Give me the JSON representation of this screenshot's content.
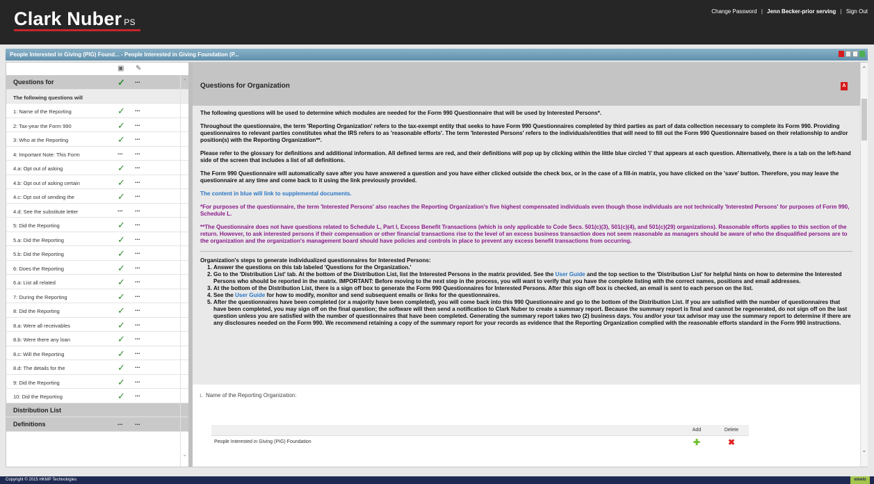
{
  "header": {
    "logo": "Clark Nuber",
    "logo_suffix": "PS",
    "links": [
      "Change Password",
      "Jenn Becker-prior serving",
      "Sign Out"
    ],
    "separator": "|"
  },
  "titlebar": {
    "title": "People Interested in Giving (PIG) Found... - People Interested in Giving Foundation (P..."
  },
  "sidebar": {
    "header_icons": [
      "print-icon",
      "pencil-icon"
    ],
    "items": [
      {
        "label": "Questions for",
        "check": "✓",
        "dots": "...",
        "type": "sec"
      },
      {
        "label": "The following questions will",
        "check": "",
        "dots": "",
        "type": "note"
      },
      {
        "label": "1: Name of the Reporting",
        "check": "✓",
        "dots": "..."
      },
      {
        "label": "2: Tax-year the Form 990",
        "check": "✓",
        "dots": "..."
      },
      {
        "label": "3: Who at the Reporting",
        "check": "✓",
        "dots": "..."
      },
      {
        "label": "4: Important Note: This Form",
        "check": "...",
        "dots": "..."
      },
      {
        "label": "4.a: Opt out of asking",
        "check": "✓",
        "dots": "..."
      },
      {
        "label": "4.b: Opt out of asking certain",
        "check": "✓",
        "dots": "..."
      },
      {
        "label": "4.c: Opt out of sending the",
        "check": "✓",
        "dots": "..."
      },
      {
        "label": "4.d: See the substitute letter",
        "check": "...",
        "dots": "..."
      },
      {
        "label": "5: Did the Reporting",
        "check": "✓",
        "dots": "..."
      },
      {
        "label": "5.a: Did the Reporting",
        "check": "✓",
        "dots": "..."
      },
      {
        "label": "5.b: Did the Reporting",
        "check": "✓",
        "dots": "..."
      },
      {
        "label": "6: Does the Reporting",
        "check": "✓",
        "dots": "..."
      },
      {
        "label": "6.a: List all related",
        "check": "✓",
        "dots": "..."
      },
      {
        "label": "7: During the Reporting",
        "check": "✓",
        "dots": "..."
      },
      {
        "label": "8: Did the Reporting",
        "check": "✓",
        "dots": "..."
      },
      {
        "label": "8.a: Were all receivables",
        "check": "✓",
        "dots": "..."
      },
      {
        "label": "8.b: Were there any loan",
        "check": "✓",
        "dots": "..."
      },
      {
        "label": "8.c: Will the Reporting",
        "check": "✓",
        "dots": "..."
      },
      {
        "label": "8.d: The details for the",
        "check": "✓",
        "dots": "..."
      },
      {
        "label": "9: Did the Reporting",
        "check": "✓",
        "dots": "..."
      },
      {
        "label": "10: Did the Reporting",
        "check": "✓",
        "dots": "..."
      },
      {
        "label": "Distribution List",
        "check": "",
        "dots": "",
        "type": "sec"
      },
      {
        "label": "Definitions",
        "check": "...",
        "dots": "...",
        "type": "sec"
      }
    ]
  },
  "main": {
    "section_title": "Questions for Organization",
    "p1": "The following questions will be used to determine which modules are needed for the Form 990 Questionnaire that will be used by Interested Persons*.",
    "p2": "Throughout the questionnaire, the term 'Reporting Organization' refers to the tax-exempt entity that seeks to have Form 990 Questionnaires completed by third parties as part of data collection necessary to complete its Form 990. Providing questionnaires to relevant parties constitutes what the IRS refers to as 'reasonable efforts'. The term 'Interested Persons' refers to the individuals/entities that will need to fill out the Form 990 Questionnaire based on their relationship to and/or position(s) with the Reporting Organization**.",
    "p3": "Please refer to the glossary for definitions and additional information. All defined terms are red, and their definitions will pop up by clicking within the little blue circled 'i' that appears at each question. Alternatively, there is a tab on the left-hand side of the screen that includes a list of all definitions.",
    "p4": "The Form 990 Questionnaire will automatically save after you have answered a question and you have either clicked outside the check box, or in the case of a fill-in matrix, you have clicked on the 'save' button. Therefore, you may leave the questionnaire at any time and come back to it using the link previously provided.",
    "p5": "The content in blue will link to supplemental documents.",
    "p6": "*For purposes of the questionnaire, the term 'Interested Persons' also reaches the Reporting Organization's five highest compensated individuals even though those individuals are not technically 'Interested Persons' for purposes of Form 990, Schedule L.",
    "p7": "**The Questionnaire does not have questions related to Schedule L, Part I, Excess Benefit Transactions (which is only applicable to Code Secs. 501(c)(3), 501(c)(4), and 501(c)(29) organizations). Reasonable efforts applies to this section of the return. However, to ask interested persons if their compensation or other financial transactions rise to the level of an excess business transaction does not seem reasonable as managers should be aware of who the disqualified persons are to the organization and the organization's management board should have policies and controls in place to prevent any excess benefit transactions from occurring.",
    "steps_title": "Organization's steps to generate individualized questionnaires for Interested Persons:",
    "step1": "Answer the questions on this tab labeled 'Questions for the Organization.'",
    "step2a": "Go to the 'Distribution List' tab. At the bottom of the Distribution List, list the Interested Persons in the matrix provided. See the",
    "step2_link": "User Guide",
    "step2b": "and the top section to the 'Distribution List' for helpful hints on how to determine the Interested Persons who should be reported in the matrix. IMPORTANT: Before moving to the next step in the process, you will want to verify that you have the complete listing with the correct names, positions and email addresses.",
    "step3": "At the bottom of the Distribution List, there is a sign off box to generate the Form 990 Questionnaires for Interested Persons. After this sign off box is checked, an email is sent to each person on the list.",
    "step4a": "See the",
    "step4_link": "User Guide",
    "step4b": "for how to modify, monitor and send subsequent emails or links for the questionnaires.",
    "step5": "After the questionnaires have been completed (or a majority have been completed), you will come back into this 990 Questionnaire and go to the bottom of the Distribution List. If you are satisfied with the number of questionnaires that have been completed, you may sign off on the final question; the software will then send a notification to Clark Nuber to create a summary report. Because the summary report is final and cannot be regenerated, do not sign off on the last question unless you are satisfied with the number of questionnaires that have been completed. Generating the summary report takes two (2) business days. You and/or your tax advisor may use the summary report to determine if there are any disclosures needed on the Form 990. We recommend retaining a copy of the summary report for your records as evidence that the Reporting Organization complied with the reasonable efforts standard in the Form 990 instructions.",
    "q1_num": "1.",
    "q1_label": "Name of the Reporting Organization:",
    "table": {
      "headers": [
        "",
        "Add",
        "Delete"
      ],
      "row": "People Interested in Giving (PIG) Foundation"
    }
  },
  "footer": {
    "copyright": "Copyright © 2015 HKMP Technologies",
    "brand": "emelo"
  },
  "colors": {
    "header_bg": "#262626",
    "accent_red": "#c5262c",
    "link_blue": "#2876c4",
    "purple_text": "#8a1b8a",
    "check_green": "#2e8b2e"
  }
}
